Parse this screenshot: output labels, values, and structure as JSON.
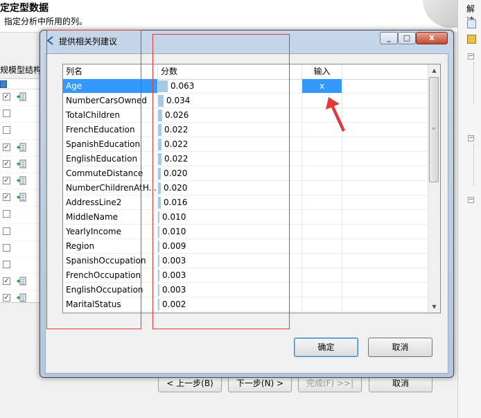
{
  "background": {
    "title": "定定型数据",
    "subtitle": "指定分析中所用的列。",
    "structure_label": "规模型结构(",
    "rows_checked": [
      true,
      false,
      false,
      true,
      true,
      true,
      true,
      false,
      false,
      false,
      false,
      true,
      true
    ],
    "rows_icon": [
      true,
      false,
      false,
      true,
      true,
      true,
      true,
      false,
      false,
      false,
      false,
      true,
      true
    ],
    "buttons": {
      "back": "< 上一步(B)",
      "next": "下一步(N) >",
      "finish": "完成(F) >>|",
      "cancel": "取消"
    }
  },
  "right_panel": {
    "title": "解决"
  },
  "dialog": {
    "title": "提供相关列建议",
    "columns": {
      "name": "列名",
      "score": "分数",
      "input": "输入"
    },
    "rows": [
      {
        "name": "Age",
        "score": "0.063",
        "value": 0.063,
        "input": "x",
        "selected": true
      },
      {
        "name": "NumberCarsOwned",
        "score": "0.034",
        "value": 0.034,
        "input": "",
        "selected": false
      },
      {
        "name": "TotalChildren",
        "score": "0.026",
        "value": 0.026,
        "input": "",
        "selected": false
      },
      {
        "name": "FrenchEducation",
        "score": "0.022",
        "value": 0.022,
        "input": "",
        "selected": false
      },
      {
        "name": "SpanishEducation",
        "score": "0.022",
        "value": 0.022,
        "input": "",
        "selected": false
      },
      {
        "name": "EnglishEducation",
        "score": "0.022",
        "value": 0.022,
        "input": "",
        "selected": false
      },
      {
        "name": "CommuteDistance",
        "score": "0.020",
        "value": 0.02,
        "input": "",
        "selected": false
      },
      {
        "name": "NumberChildrenAtH...",
        "score": "0.020",
        "value": 0.02,
        "input": "",
        "selected": false
      },
      {
        "name": "AddressLine2",
        "score": "0.016",
        "value": 0.016,
        "input": "",
        "selected": false
      },
      {
        "name": "MiddleName",
        "score": "0.010",
        "value": 0.01,
        "input": "",
        "selected": false
      },
      {
        "name": "YearlyIncome",
        "score": "0.010",
        "value": 0.01,
        "input": "",
        "selected": false
      },
      {
        "name": "Region",
        "score": "0.009",
        "value": 0.009,
        "input": "",
        "selected": false
      },
      {
        "name": "SpanishOccupation",
        "score": "0.003",
        "value": 0.003,
        "input": "",
        "selected": false
      },
      {
        "name": "FrenchOccupation",
        "score": "0.003",
        "value": 0.003,
        "input": "",
        "selected": false
      },
      {
        "name": "EnglishOccupation",
        "score": "0.003",
        "value": 0.003,
        "input": "",
        "selected": false
      },
      {
        "name": "MaritalStatus",
        "score": "0.002",
        "value": 0.002,
        "input": "",
        "selected": false
      }
    ],
    "ok_label": "确定",
    "cancel_label": "取消",
    "close_glyph": "x",
    "min_glyph": "_",
    "max_glyph": "□"
  },
  "colors": {
    "annotation": "#e23a3a",
    "selection": "#3399ff",
    "score_bar": "#a7c9e3"
  }
}
